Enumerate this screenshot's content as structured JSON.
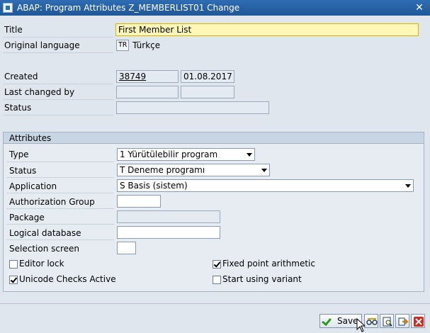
{
  "window": {
    "title": "ABAP: Program Attributes Z_MEMBERLIST01 Change",
    "close_symbol": "✕"
  },
  "header": {
    "title_label": "Title",
    "title_value": "First Member List",
    "orig_lang_label": "Original language",
    "orig_lang_code": "TR",
    "orig_lang_name": "Türkçe"
  },
  "admin": {
    "created_label": "Created",
    "created_by": "38749",
    "created_on": "01.08.2017",
    "last_changed_label": "Last changed by",
    "last_changed_by": "",
    "last_changed_on": "",
    "status_label": "Status",
    "status_value": ""
  },
  "attributes": {
    "group_title": "Attributes",
    "type_label": "Type",
    "type_value": "1 Yürütülebilir program",
    "status_label": "Status",
    "status_value": "T Deneme programı",
    "application_label": "Application",
    "application_value": "S Basis (sistem)",
    "auth_group_label": "Authorization Group",
    "auth_group_value": "",
    "package_label": "Package",
    "package_value": "",
    "ldb_label": "Logical database",
    "ldb_value": "",
    "sel_screen_label": "Selection screen",
    "sel_screen_value": "",
    "editor_lock_label": "Editor lock",
    "editor_lock_checked": false,
    "unicode_label": "Unicode Checks Active",
    "unicode_checked": true,
    "fixed_point_label": "Fixed point arithmetic",
    "fixed_point_checked": true,
    "variant_label": "Start using variant",
    "variant_checked": false
  },
  "footer": {
    "save_label": "Save"
  },
  "colors": {
    "titlebar": "#1f5797",
    "highlight_field": "#fff7b5",
    "check_green": "#2e9b20",
    "cancel_red": "#d22a1e"
  },
  "icons": [
    "check-icon",
    "glasses-icon",
    "display-icon",
    "transfer-icon",
    "cancel-icon"
  ]
}
